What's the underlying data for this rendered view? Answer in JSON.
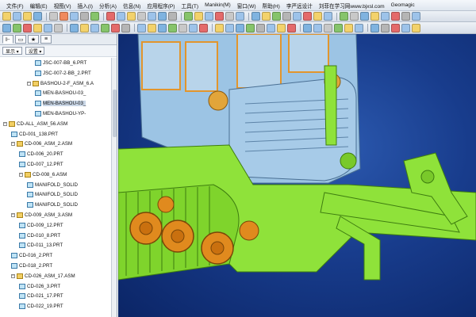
{
  "menu": [
    "文件(F)",
    "编辑(E)",
    "视图(V)",
    "插入(I)",
    "分析(A)",
    "信息(N)",
    "应用程序(P)",
    "工具(T)",
    "Manikin(M)",
    "窗口(W)",
    "帮助(H)",
    "李严远设计",
    "刘菲在学习网www.bjxsl.com",
    "Geomagic"
  ],
  "colors": {
    "viewport_bg": "#183c8c",
    "chassis_green": "#8fe23a",
    "cab_blue": "#9cc4e4",
    "wheel_orange": "#e08a1e"
  },
  "navigator": {
    "tabs": [
      "model-tree-icon",
      "folder-icon",
      "star-icon",
      "layers-icon"
    ],
    "dropdown1": "显示 ▾",
    "dropdown2": "设置 ▾"
  },
  "tree": [
    {
      "label": "JSC-007-BB_6.PRT",
      "indent": 5,
      "type": "prt"
    },
    {
      "label": "JSC-007-2-BB_2.PRT",
      "indent": 5,
      "type": "prt"
    },
    {
      "label": "BASHOU-2-F_ASM_6.A",
      "indent": 4,
      "type": "asm",
      "twist": "−"
    },
    {
      "label": "MEN-BASHOU-03_",
      "indent": 5,
      "type": "prt"
    },
    {
      "label": "MEN-BASHOU-03_",
      "indent": 5,
      "type": "prt",
      "selected": true
    },
    {
      "label": "MEN-BASHOU-YP-",
      "indent": 5,
      "type": "prt"
    },
    {
      "label": "CD-ALL_ASM_56.ASM",
      "indent": 1,
      "type": "asm",
      "twist": "−"
    },
    {
      "label": "CD-001_138.PRT",
      "indent": 2,
      "type": "prt"
    },
    {
      "label": "CD-006_ASM_2.ASM",
      "indent": 2,
      "type": "asm",
      "twist": "−"
    },
    {
      "label": "CD-006_20.PRT",
      "indent": 3,
      "type": "prt"
    },
    {
      "label": "CD-007_12.PRT",
      "indent": 3,
      "type": "prt"
    },
    {
      "label": "CD-008_6.ASM",
      "indent": 3,
      "type": "asm",
      "twist": "−"
    },
    {
      "label": "MANIFOLD_SOLID",
      "indent": 4,
      "type": "prt"
    },
    {
      "label": "MANIFOLD_SOLID",
      "indent": 4,
      "type": "prt"
    },
    {
      "label": "MANIFOLD_SOLID",
      "indent": 4,
      "type": "prt"
    },
    {
      "label": "CD-009_ASM_3.ASM",
      "indent": 2,
      "type": "asm",
      "twist": "−"
    },
    {
      "label": "CD-009_12.PRT",
      "indent": 3,
      "type": "prt"
    },
    {
      "label": "CD-010_8.PRT",
      "indent": 3,
      "type": "prt"
    },
    {
      "label": "CD-011_13.PRT",
      "indent": 3,
      "type": "prt"
    },
    {
      "label": "CD-016_2.PRT",
      "indent": 2,
      "type": "prt"
    },
    {
      "label": "CD-018_2.PRT",
      "indent": 2,
      "type": "prt"
    },
    {
      "label": "CD-026_ASM_17.ASM",
      "indent": 2,
      "type": "asm",
      "twist": "−"
    },
    {
      "label": "CD-026_3.PRT",
      "indent": 3,
      "type": "prt"
    },
    {
      "label": "CD-021_17.PRT",
      "indent": 3,
      "type": "prt"
    },
    {
      "label": "CD-022_19.PRT",
      "indent": 3,
      "type": "prt"
    }
  ]
}
